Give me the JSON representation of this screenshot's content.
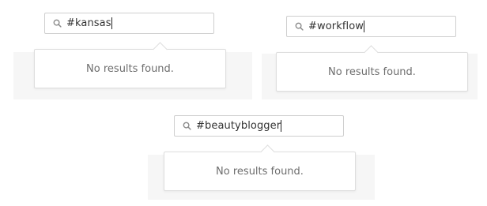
{
  "widgets": [
    {
      "query": "#kansas",
      "empty_message": "No results found."
    },
    {
      "query": "#workflow",
      "empty_message": "No results found."
    },
    {
      "query": "#beautyblogger",
      "empty_message": "No results found."
    }
  ],
  "icons": {
    "search": "search-icon"
  },
  "colors": {
    "panel_background": "#f6f6f6",
    "input_border": "#cfcfcf",
    "dropdown_border": "#dedede",
    "text_primary": "#333333",
    "text_muted": "#6d6d6d"
  }
}
